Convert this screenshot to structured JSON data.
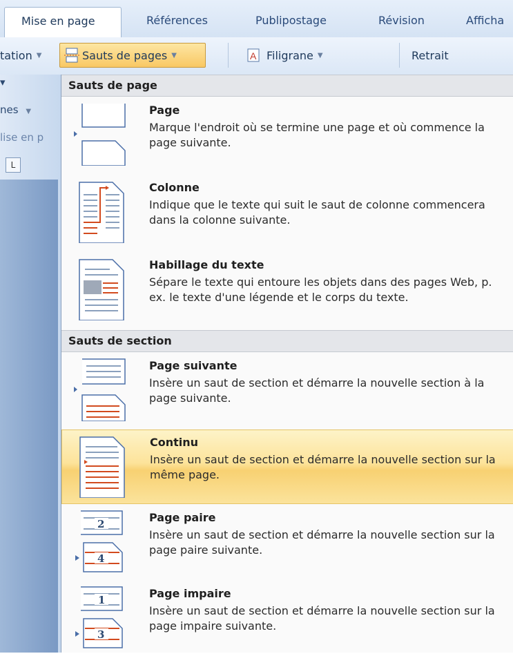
{
  "ribbon": {
    "tabs": [
      "Mise en page",
      "Références",
      "Publipostage",
      "Révision",
      "Afficha"
    ],
    "active_tab": "Mise en page",
    "buttons": {
      "orientation": "tation",
      "breaks": "Sauts de pages",
      "watermark": "Filigrane",
      "indent": "Retrait"
    }
  },
  "left_panel": {
    "lines_label": "nes",
    "group_label": "lise en p",
    "ruler_tab": "L"
  },
  "menu": {
    "page_breaks_header": "Sauts de page",
    "section_breaks_header": "Sauts de section",
    "items": [
      {
        "title": "Page",
        "desc": "Marque l'endroit où se termine une page et où commence la page suivante.",
        "icon": "page-break-icon"
      },
      {
        "title": "Colonne",
        "desc": "Indique que le texte qui suit le saut de colonne commencera dans la colonne suivante.",
        "icon": "column-break-icon"
      },
      {
        "title": "Habillage du texte",
        "desc": "Sépare le texte qui entoure les objets dans des pages Web, p. ex. le texte d'une légende et le corps du texte.",
        "icon": "text-wrapping-icon"
      },
      {
        "title": "Page suivante",
        "desc": "Insère un saut de section et démarre la nouvelle section à la page suivante.",
        "icon": "next-page-icon"
      },
      {
        "title": "Continu",
        "desc": "Insère un saut de section et démarre la nouvelle section sur la même page.",
        "icon": "continuous-icon",
        "highlighted": true
      },
      {
        "title": "Page paire",
        "desc": "Insère un saut de section et démarre la nouvelle section sur la page paire suivante.",
        "icon": "even-page-icon",
        "numbers": [
          "2",
          "4"
        ]
      },
      {
        "title": "Page impaire",
        "desc": "Insère un saut de section et démarre la nouvelle section sur la page impaire suivante.",
        "icon": "odd-page-icon",
        "numbers": [
          "1",
          "3"
        ]
      }
    ]
  },
  "colors": {
    "accent_highlight": "#f8d172",
    "break_marker": "#d24a1e",
    "ribbon_text": "#1e395b"
  }
}
